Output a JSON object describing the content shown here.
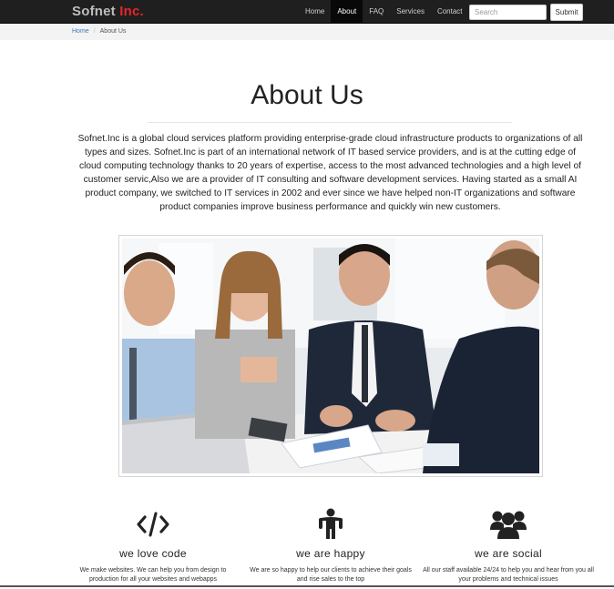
{
  "navbar": {
    "brand_main": "Sofnet",
    "brand_accent": "Inc.",
    "items": [
      {
        "label": "Home"
      },
      {
        "label": "About"
      },
      {
        "label": "FAQ"
      },
      {
        "label": "Services"
      },
      {
        "label": "Contact"
      }
    ],
    "active_item": "About",
    "search_placeholder": "Search",
    "submit_label": "Submit"
  },
  "breadcrumb": {
    "home": "Home",
    "separator": "/",
    "current": "About Us"
  },
  "main": {
    "title": "About Us",
    "intro": "Sofnet.Inc is a global cloud services platform providing enterprise-grade cloud infrastructure products to organizations of all types and sizes. Sofnet.Inc is part of an international network of IT based service providers, and is at the cutting edge of cloud computing technology thanks to 20 years of expertise, access to the most advanced technologies and a high level of customer servic,Also we are a provider of IT consulting and software development services. Having started as a small AI product company, we switched to IT services in 2002 and ever since we have helped non-IT organizations and software product companies improve business performance and quickly win new customers."
  },
  "features": [
    {
      "icon": "code-icon",
      "title": "we love code",
      "text": "We make websites. We can help you from design to production for all your websites and webapps"
    },
    {
      "icon": "person-icon",
      "title": "we are happy",
      "text": "We are so happy to help our clients to achieve their goals and rise sales to the top"
    },
    {
      "icon": "users-icon",
      "title": "we are social",
      "text": "All our staff available 24/24 to help you and hear from you all your problems and technical issues"
    }
  ],
  "colors": {
    "navbar_bg": "#1f1f1f",
    "brand_accent": "#e5262a",
    "link": "#2f7bbf"
  }
}
